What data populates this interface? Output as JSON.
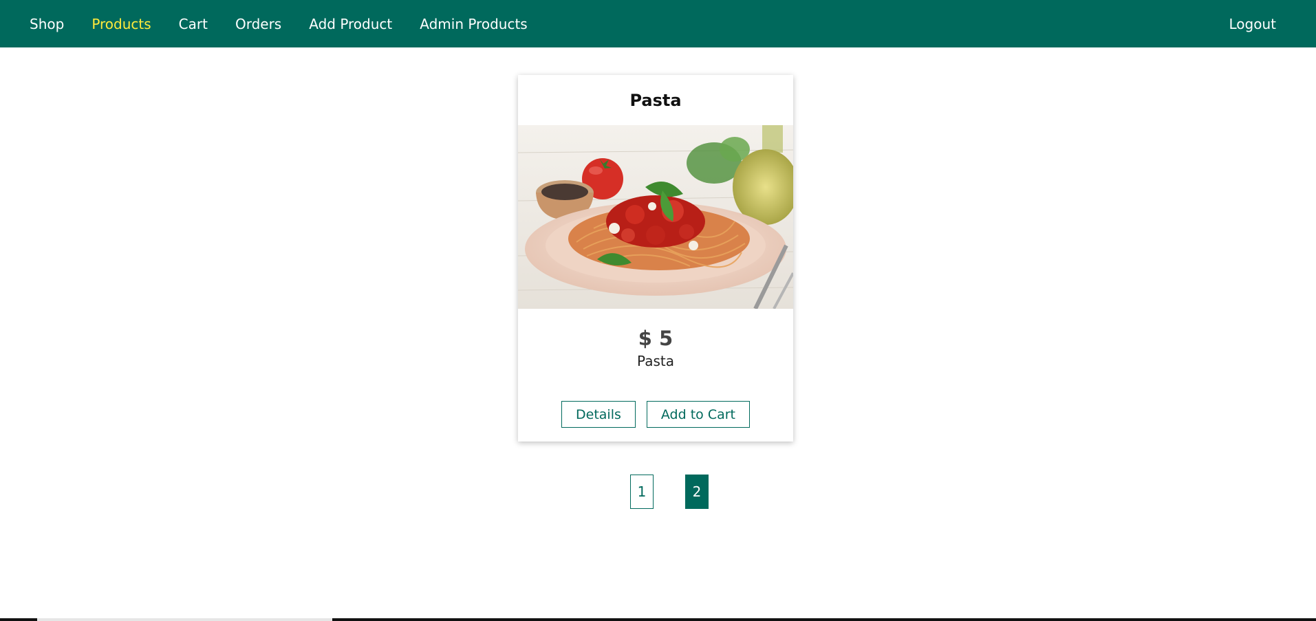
{
  "nav": {
    "items": [
      {
        "label": "Shop",
        "active": false
      },
      {
        "label": "Products",
        "active": true
      },
      {
        "label": "Cart",
        "active": false
      },
      {
        "label": "Orders",
        "active": false
      },
      {
        "label": "Add Product",
        "active": false
      },
      {
        "label": "Admin Products",
        "active": false
      }
    ],
    "logout_label": "Logout"
  },
  "product": {
    "title": "Pasta",
    "price": "$ 5",
    "description": "Pasta",
    "image_icon": "pasta-dish-image",
    "details_label": "Details",
    "add_to_cart_label": "Add to Cart"
  },
  "pagination": {
    "pages": [
      "1",
      "2"
    ],
    "current": "2"
  },
  "colors": {
    "brand": "#00695c",
    "active_nav": "#ffeb3b"
  }
}
